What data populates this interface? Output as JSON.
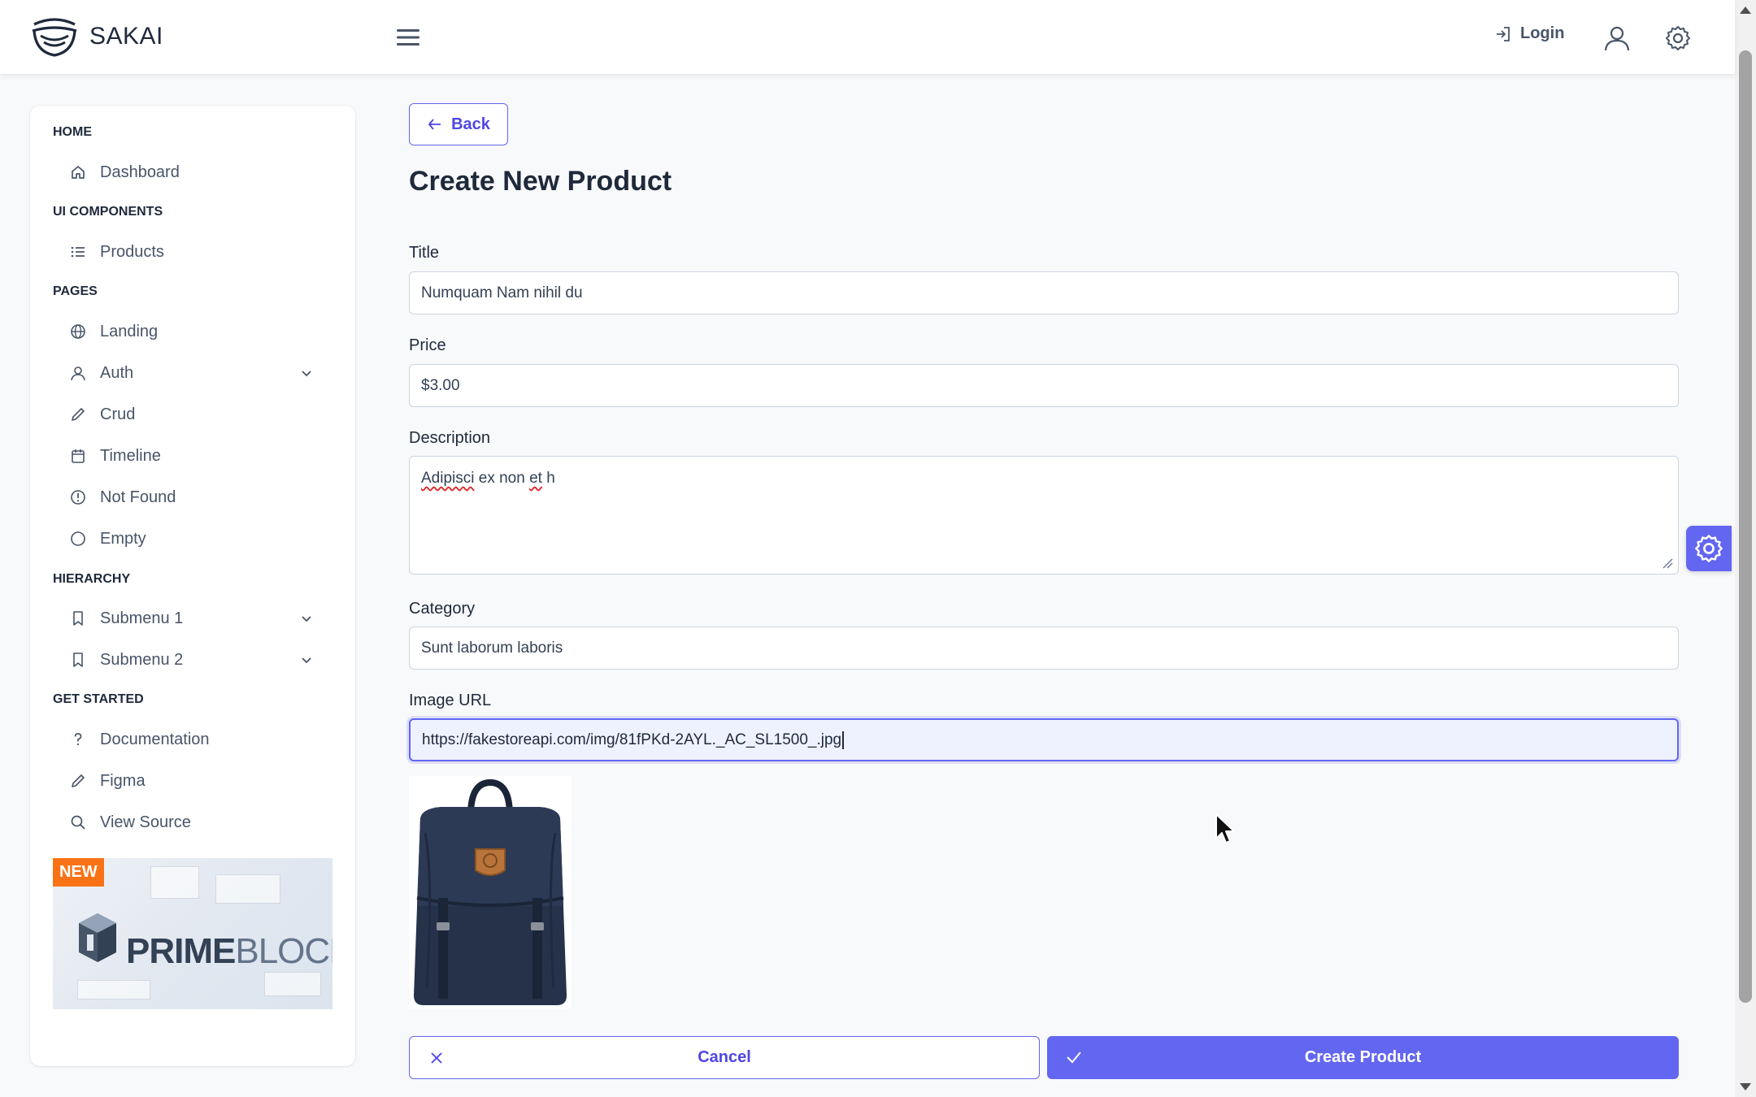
{
  "app": {
    "name": "SAKAI"
  },
  "topbar": {
    "login_label": "Login",
    "icons": [
      "menu-icon",
      "login-icon",
      "user-icon",
      "settings-icon"
    ]
  },
  "sidebar": {
    "sections": [
      {
        "title": "HOME",
        "items": [
          {
            "label": "Dashboard",
            "icon": "home-icon"
          }
        ]
      },
      {
        "title": "UI COMPONENTS",
        "items": [
          {
            "label": "Products",
            "icon": "list-icon"
          }
        ]
      },
      {
        "title": "PAGES",
        "items": [
          {
            "label": "Landing",
            "icon": "globe-icon"
          },
          {
            "label": "Auth",
            "icon": "user-icon",
            "expandable": true
          },
          {
            "label": "Crud",
            "icon": "pencil-icon"
          },
          {
            "label": "Timeline",
            "icon": "calendar-icon"
          },
          {
            "label": "Not Found",
            "icon": "exclamation-icon"
          },
          {
            "label": "Empty",
            "icon": "circle-icon"
          }
        ]
      },
      {
        "title": "HIERARCHY",
        "items": [
          {
            "label": "Submenu 1",
            "icon": "bookmark-icon",
            "expandable": true
          },
          {
            "label": "Submenu 2",
            "icon": "bookmark-icon",
            "expandable": true
          }
        ]
      },
      {
        "title": "GET STARTED",
        "items": [
          {
            "label": "Documentation",
            "icon": "question-icon"
          },
          {
            "label": "Figma",
            "icon": "pencil-icon"
          },
          {
            "label": "View Source",
            "icon": "search-icon"
          }
        ]
      }
    ],
    "promo": {
      "badge": "NEW",
      "title_bold": "PRIME",
      "title_light": "BLOCKS"
    }
  },
  "main": {
    "back_label": "Back",
    "page_title": "Create New Product",
    "form": {
      "title_label": "Title",
      "title_value": "Numquam Nam nihil du",
      "price_label": "Price",
      "price_value": "$3.00",
      "description_label": "Description",
      "description_misspelled": "Adipisci",
      "description_mid": " ex non ",
      "description_misspelled2": "et",
      "description_end": " h",
      "category_label": "Category",
      "category_value": "Sunt laborum laboris",
      "image_label": "Image URL",
      "image_value": "https://fakestoreapi.com/img/81fPKd-2AYL._AC_SL1500_.jpg"
    },
    "cancel_label": "Cancel",
    "create_label": "Create Product"
  },
  "colors": {
    "primary": "#6366f1",
    "primary_text": "#4f46e5",
    "promo_badge": "#f97316"
  }
}
